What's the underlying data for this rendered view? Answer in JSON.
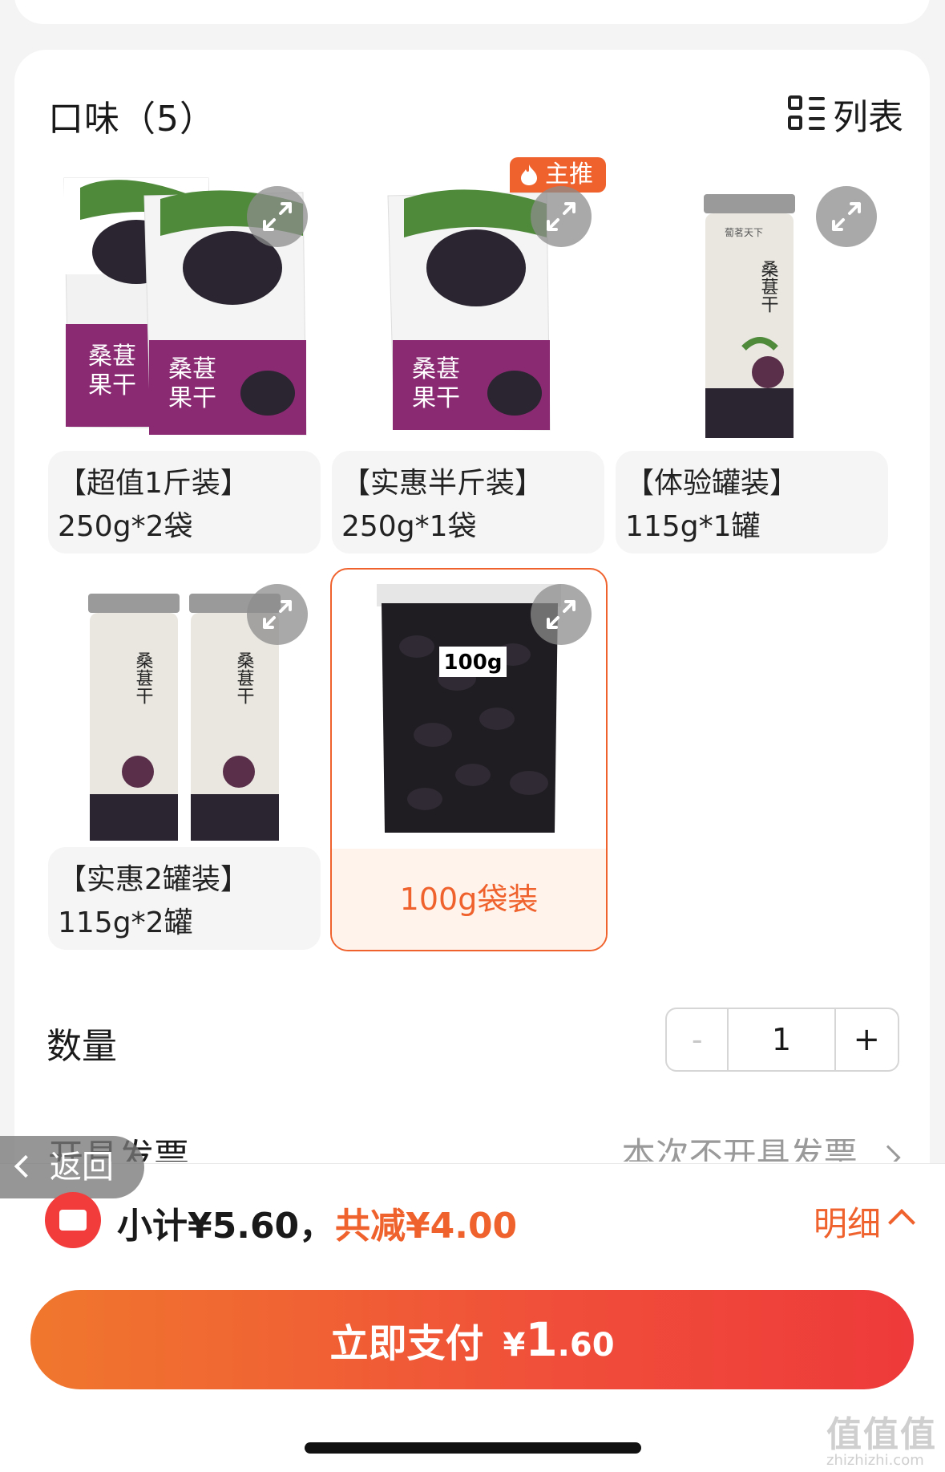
{
  "header": {
    "flavor_title": "口味（5）",
    "list_toggle_label": "列表"
  },
  "options": [
    {
      "line1": "【超值1斤装】",
      "line2": "250g*2袋",
      "selected": false,
      "hot": false
    },
    {
      "line1": "【实惠半斤装】",
      "line2": "250g*1袋",
      "selected": false,
      "hot": true
    },
    {
      "line1": "【体验罐装】",
      "line2": "115g*1罐",
      "selected": false,
      "hot": false
    },
    {
      "line1": "【实惠2罐装】",
      "line2": "115g*2罐",
      "selected": false,
      "hot": false
    },
    {
      "line1": "100g袋装",
      "line2": "",
      "selected": true,
      "hot": false
    }
  ],
  "hot_badge": "主推",
  "product_art": {
    "bag_name_line1": "桑葚",
    "bag_name_line2": "果干",
    "jar_brand": "蔔茗天下",
    "jar_name": "桑葚干",
    "pouch_weight": "100g"
  },
  "quantity": {
    "label": "数量",
    "minus": "-",
    "value": "1",
    "plus": "+"
  },
  "invoice": {
    "label": "开具发票",
    "value": "本次不开具发票"
  },
  "back_label": "返回",
  "summary": {
    "subtotal": "小计¥5.60，",
    "discount": "共减¥4.00",
    "detail": "明细"
  },
  "pay": {
    "label": "立即支付",
    "currency": "¥",
    "amount_int": "1",
    "amount_dec": ".60"
  },
  "watermark": {
    "main": "值值值",
    "sub": "zhizhizhi.com"
  },
  "colors": {
    "accent": "#f0622d",
    "coupon_red": "#f23b3b",
    "bag_purple": "#8a2a72",
    "berry_dark": "#2a2530"
  }
}
